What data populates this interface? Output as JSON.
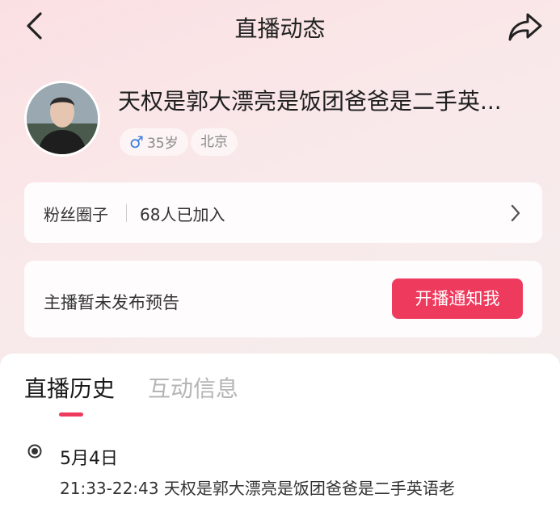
{
  "header": {
    "title": "直播动态",
    "back_icon": "chevron-left-icon",
    "share_icon": "share-arrow-icon"
  },
  "profile": {
    "name": "天权是郭大漂亮是饭团爸爸是二手英...",
    "gender_symbol": "♂",
    "age": "35岁",
    "city": "北京"
  },
  "fans_circle": {
    "label": "粉丝圈子",
    "count_text": "68人已加入"
  },
  "preview": {
    "text": "主播暂未发布预告",
    "notify_button": "开播通知我"
  },
  "tabs": [
    {
      "label": "直播历史",
      "active": true
    },
    {
      "label": "互动信息",
      "active": false
    }
  ],
  "history": [
    {
      "date": "5月4日",
      "record": "21:33-22:43 天权是郭大漂亮是饭团爸爸是二手英语老"
    }
  ],
  "colors": {
    "accent": "#ee3a5c",
    "gender_blue": "#3d7ce0"
  }
}
